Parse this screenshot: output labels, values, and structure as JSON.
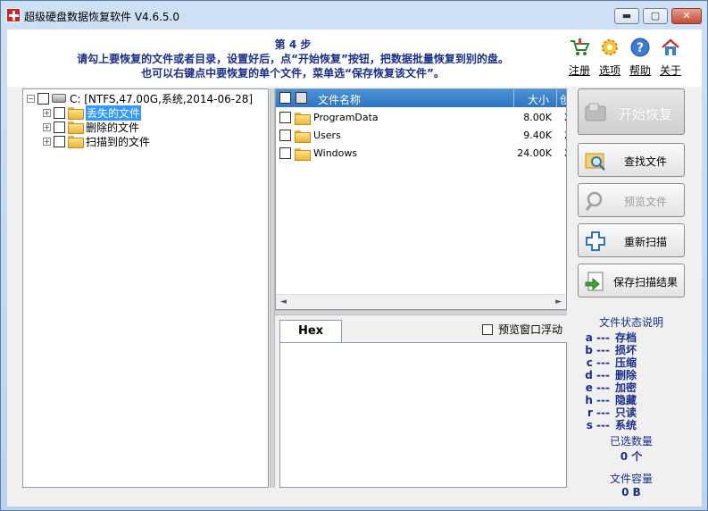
{
  "window": {
    "title": "超级硬盘数据恢复软件 V4.6.5.0",
    "controls": {
      "minimize": "▬",
      "maximize": "▢",
      "close": "✕"
    }
  },
  "header": {
    "step": "第 4 步",
    "instruction_line1": "请勾上要恢复的文件或者目录，设置好后，点“开始恢复”按钮，把数据批量恢复到别的盘。",
    "instruction_line2": "也可以右键点中要恢复的单个文件，菜单选“保存恢复该文件”。"
  },
  "top_icons": [
    {
      "name": "register",
      "label": "注册",
      "icon": "cart-icon"
    },
    {
      "name": "options",
      "label": "选项",
      "icon": "gear-icon"
    },
    {
      "name": "help",
      "label": "帮助",
      "icon": "help-icon"
    },
    {
      "name": "about",
      "label": "关于",
      "icon": "house-icon"
    }
  ],
  "tree": {
    "root": "C:  [NTFS,47.00G,系统,2014-06-28]",
    "items": [
      {
        "label": "丢失的文件",
        "selected": true
      },
      {
        "label": "删除的文件",
        "selected": false
      },
      {
        "label": "扫描到的文件",
        "selected": false
      }
    ]
  },
  "file_list": {
    "columns": {
      "name": "文件名称",
      "size": "大小",
      "extra": "创"
    },
    "rows": [
      {
        "name": "ProgramData",
        "size": "8.00K",
        "extra": "2"
      },
      {
        "name": "Users",
        "size": "9.40K",
        "extra": "2"
      },
      {
        "name": "Windows",
        "size": "24.00K",
        "extra": "2"
      }
    ]
  },
  "hex": {
    "tab": "Hex",
    "float_label": "预览窗口浮动"
  },
  "actions": {
    "start": "开始恢复",
    "find": "查找文件",
    "preview": "预览文件",
    "rescan": "重新扫描",
    "save_scan": "保存扫描结果"
  },
  "legend": {
    "title": "文件状态说明",
    "items": [
      {
        "key": "a ---",
        "value": "存档"
      },
      {
        "key": "b ---",
        "value": "损坏"
      },
      {
        "key": "c ---",
        "value": "压缩"
      },
      {
        "key": "d ---",
        "value": "删除"
      },
      {
        "key": "e ---",
        "value": "加密"
      },
      {
        "key": "h ---",
        "value": "隐藏"
      },
      {
        "key": "r ---",
        "value": "只读"
      },
      {
        "key": "s ---",
        "value": "系统"
      }
    ],
    "selected_count_label": "已选数量",
    "selected_count_value": "0 个",
    "capacity_label": "文件容量",
    "capacity_value": "0 B"
  }
}
